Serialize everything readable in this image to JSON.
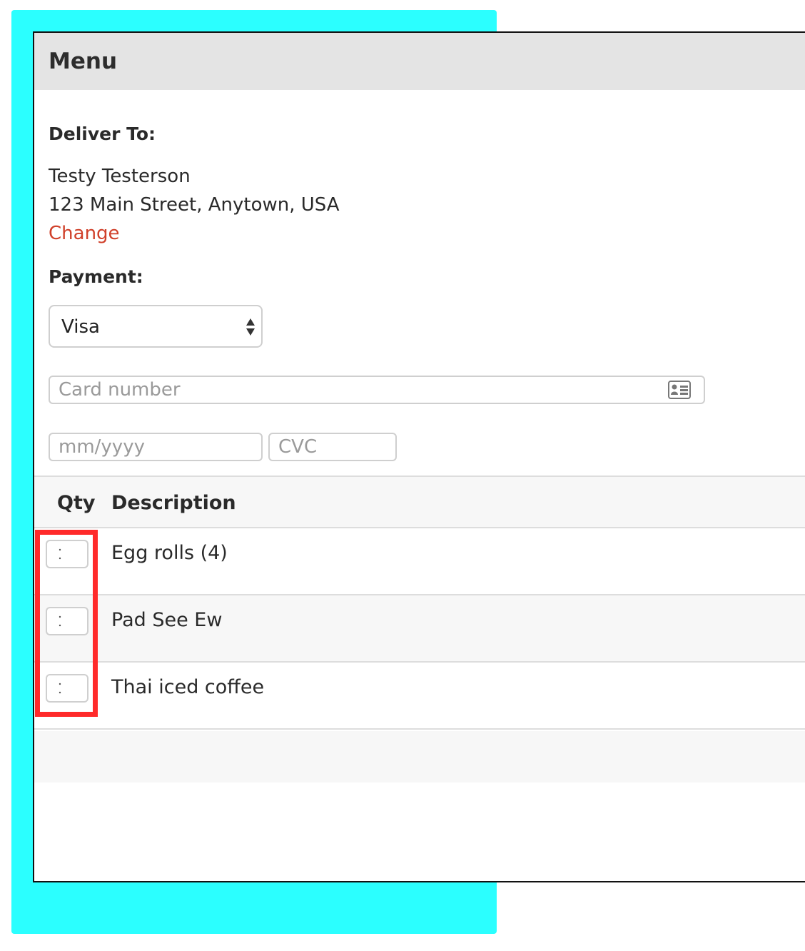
{
  "window": {
    "title": "Menu"
  },
  "delivery": {
    "label": "Deliver To:",
    "name": "Testy Testerson",
    "address": "123 Main Street, Anytown, USA",
    "change_link": "Change"
  },
  "payment": {
    "label": "Payment:",
    "method_selected": "Visa",
    "card_number_placeholder": "Card number",
    "expiry_placeholder": "mm/yyyy",
    "cvc_placeholder": "CVC"
  },
  "order_table": {
    "columns": [
      "Qty",
      "Description"
    ],
    "rows": [
      {
        "qty": "",
        "description": "Egg rolls (4)"
      },
      {
        "qty": "",
        "description": "Pad See Ew"
      },
      {
        "qty": "",
        "description": "Thai iced coffee"
      }
    ]
  },
  "colors": {
    "backdrop": "#2bffff",
    "link": "#d0402a",
    "highlight": "#ff2a2a"
  }
}
